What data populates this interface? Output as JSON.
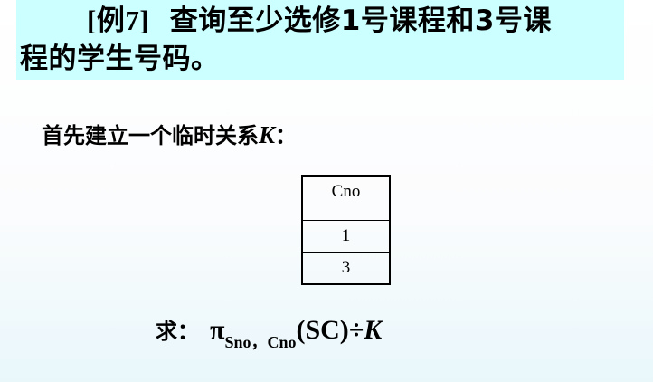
{
  "title": {
    "tag": "[例7]",
    "line1_text": "查询至少选修1号课程和3号课",
    "line2_text": "程的学生号码。"
  },
  "intro": {
    "text": "首先建立一个临时关系",
    "relation_name": "K",
    "colon": "："
  },
  "relation_table": {
    "header": "Cno",
    "rows": [
      "1",
      "3"
    ]
  },
  "formula": {
    "label": "求：",
    "operator": "π",
    "subscript": "Sno，Cno",
    "argument": "(SC)",
    "division": "÷",
    "divisor": "K"
  }
}
